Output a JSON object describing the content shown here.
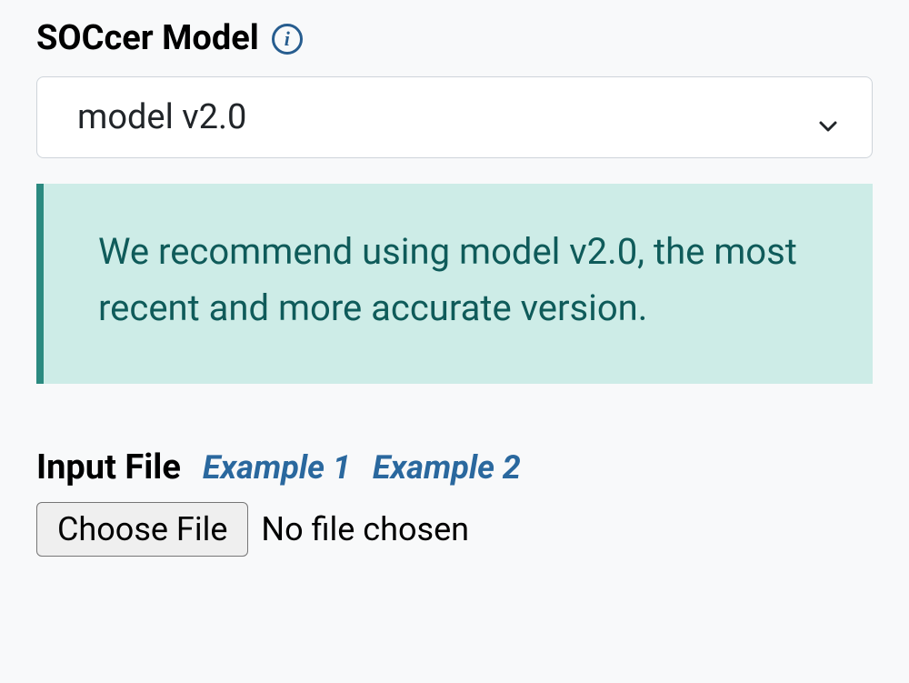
{
  "model_section": {
    "label": "SOCcer Model",
    "info_icon": "i",
    "selected_value": "model v2.0"
  },
  "callout": {
    "text": "We recommend using model v2.0, the most recent and more accurate version."
  },
  "input_file_section": {
    "label": "Input File",
    "example_links": [
      {
        "label": "Example 1"
      },
      {
        "label": "Example 2"
      }
    ],
    "choose_button": "Choose File",
    "status_text": "No file chosen"
  }
}
